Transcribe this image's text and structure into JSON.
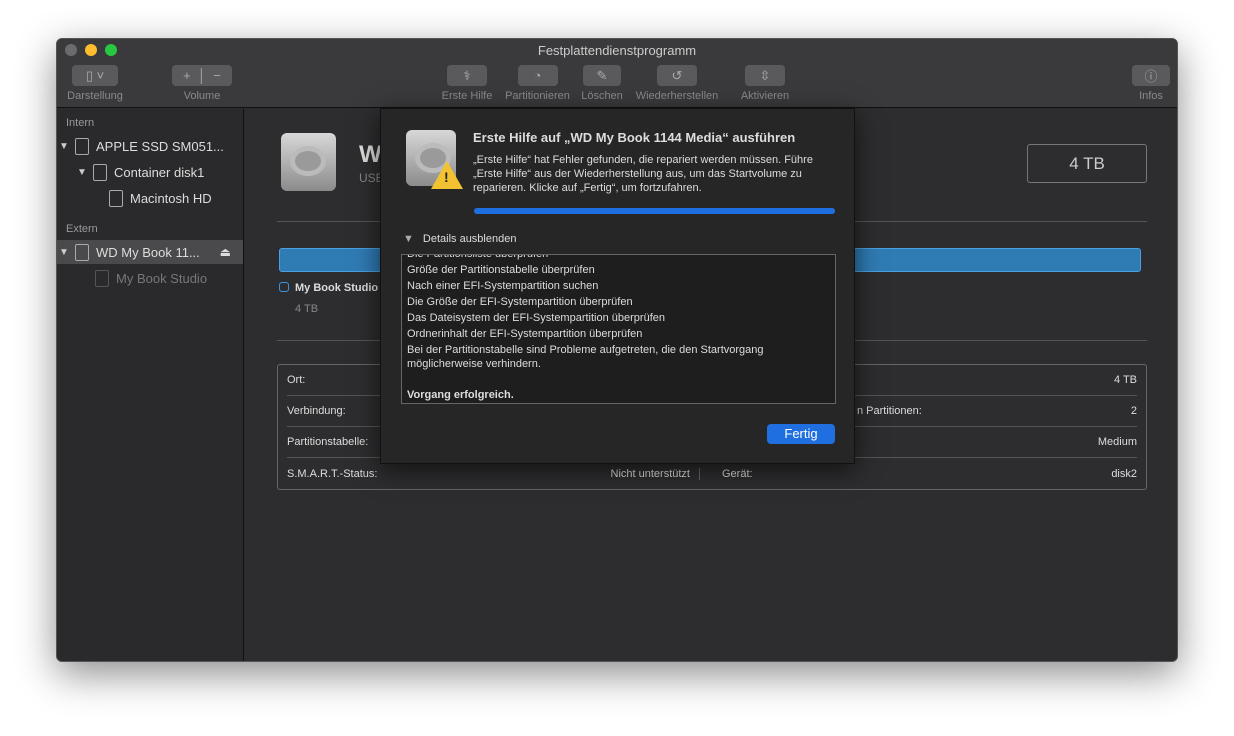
{
  "window": {
    "title": "Festplattendienstprogramm"
  },
  "toolbar": {
    "view": "Darstellung",
    "volume": "Volume",
    "first_aid": "Erste Hilfe",
    "partition": "Partitionieren",
    "erase": "Löschen",
    "restore": "Wiederherstellen",
    "mount": "Aktivieren",
    "info": "Infos"
  },
  "sidebar": {
    "internal": "Intern",
    "external": "Extern",
    "items": [
      {
        "label": "APPLE SSD SM051..."
      },
      {
        "label": "Container disk1"
      },
      {
        "label": "Macintosh HD"
      },
      {
        "label": "WD My Book 11..."
      },
      {
        "label": "My Book Studio"
      }
    ]
  },
  "main": {
    "disk_name": "W",
    "disk_sub": "USB",
    "capacity": "4 TB",
    "legend_label": "My Book Studio",
    "legend_size": "4 TB",
    "info": [
      {
        "l": "Ort:",
        "v": "",
        "l2": "",
        "v2": "4 TB"
      },
      {
        "l": "Verbindung:",
        "v": "",
        "l2": "n Partitionen:",
        "v2": "2"
      },
      {
        "l": "Partitionstabelle:",
        "v": "",
        "l2": "",
        "v2": "Medium"
      },
      {
        "l": "S.M.A.R.T.-Status:",
        "v": "Nicht unterstützt",
        "l2": "Gerät:",
        "v2": "disk2"
      }
    ]
  },
  "dialog": {
    "title": "Erste Hilfe auf „WD My Book 1144 Media“ ausführen",
    "message": "„Erste Hilfe“ hat Fehler gefunden, die repariert werden müssen. Führe „Erste Hilfe“ aus der Wiederherstellung aus, um das Startvolume zu reparieren. Klicke auf „Fertig“, um fortzufahren.",
    "progress": 100,
    "details_toggle": "Details ausblenden",
    "log": [
      "Die Partitionsliste überprüfen",
      "Größe der Partitionstabelle überprüfen",
      "Nach einer EFI-Systempartition suchen",
      "Die Größe der EFI-Systempartition überprüfen",
      "Das Dateisystem der EFI-Systempartition überprüfen",
      "Ordnerinhalt der EFI-Systempartition überprüfen",
      "Bei der Partitionstabelle sind Probleme aufgetreten, die den Startvorgang möglicherweise verhindern."
    ],
    "result": "Vorgang erfolgreich.",
    "done": "Fertig"
  },
  "colors": {
    "accent": "#1f6fe0",
    "bar": "#2f7bb4"
  }
}
